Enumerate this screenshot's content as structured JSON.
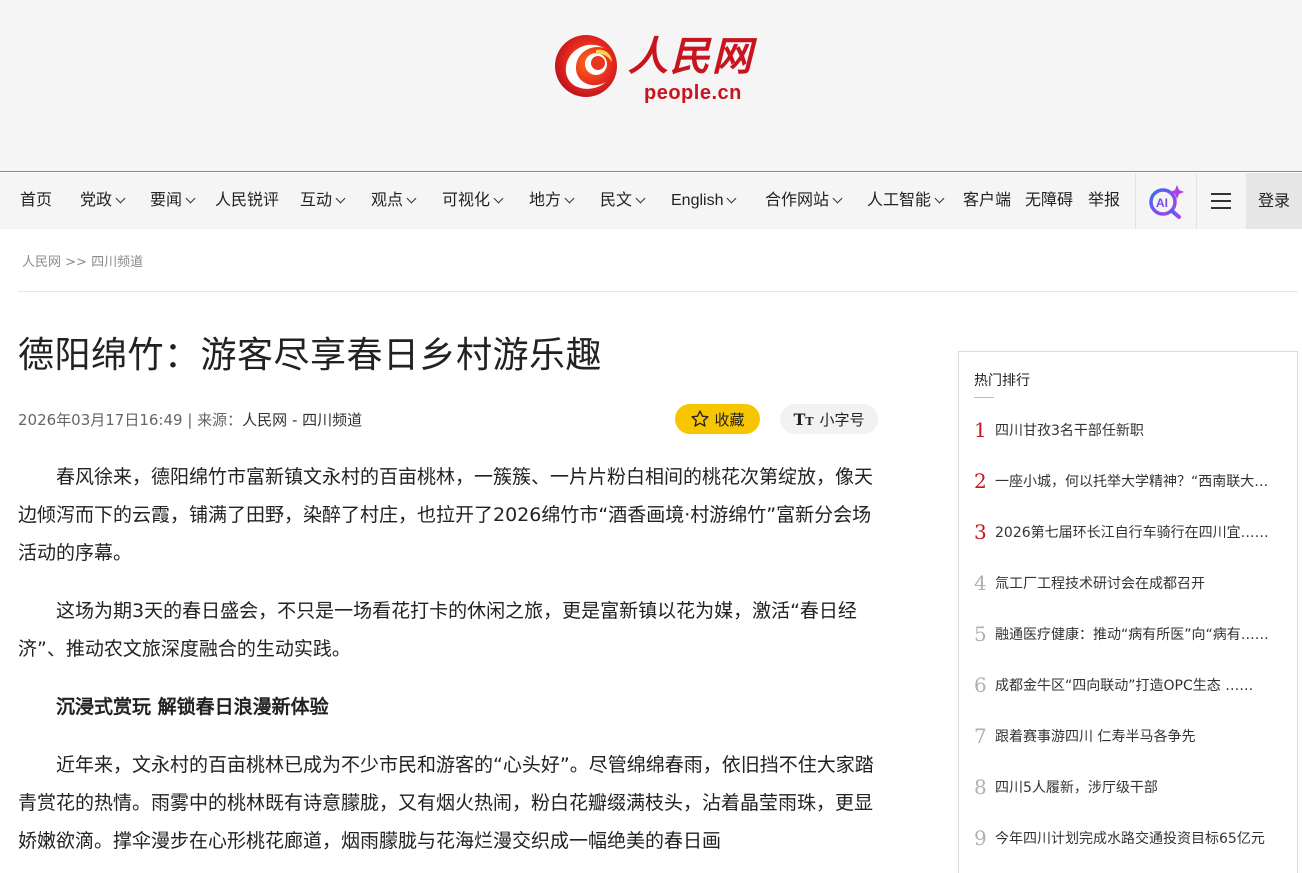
{
  "logo": {
    "cn": "人民网",
    "en": "people.cn",
    "brand_color": "#c8141e"
  },
  "nav": {
    "items": [
      {
        "label": "首页",
        "dropdown": false
      },
      {
        "label": "党政",
        "dropdown": true
      },
      {
        "label": "要闻",
        "dropdown": true
      },
      {
        "label": "人民锐评",
        "dropdown": false
      },
      {
        "label": "互动",
        "dropdown": true
      },
      {
        "label": "观点",
        "dropdown": true
      },
      {
        "label": "可视化",
        "dropdown": true
      },
      {
        "label": "地方",
        "dropdown": true
      },
      {
        "label": "民文",
        "dropdown": true
      },
      {
        "label": "English",
        "dropdown": true
      },
      {
        "label": "合作网站",
        "dropdown": true
      },
      {
        "label": "人工智能",
        "dropdown": true
      },
      {
        "label": "客户端",
        "dropdown": false
      },
      {
        "label": "无障碍",
        "dropdown": false
      },
      {
        "label": "举报",
        "dropdown": false
      }
    ],
    "ai_icon": "ai-search-icon",
    "menu_icon": "hamburger-menu-icon",
    "login": "登录"
  },
  "breadcrumb": {
    "home": "人民网",
    "sep": ">>",
    "channel": "四川频道"
  },
  "article": {
    "title": "德阳绵竹：游客尽享春日乡村游乐趣",
    "datetime": "2026年03月17日16:49",
    "source_prefix": " | 来源：",
    "source": "人民网 - 四川频道",
    "favorite_label": "收藏",
    "favorite_color": "#f7c600",
    "font_label": "小字号",
    "paragraphs": [
      "春风徐来，德阳绵竹市富新镇文永村的百亩桃林，一簇簇、一片片粉白相间的桃花次第绽放，像天边倾泻而下的云霞，铺满了田野，染醉了村庄，也拉开了2026绵竹市“酒香画境·村游绵竹”富新分会场活动的序幕。",
      "这场为期3天的春日盛会，不只是一场看花打卡的休闲之旅，更是富新镇以花为媒，激活“春日经济”、推动农文旅深度融合的生动实践。",
      "沉浸式赏玩 解锁春日浪漫新体验",
      "近年来，文永村的百亩桃林已成为不少市民和游客的“心头好”。尽管绵绵春雨，依旧挡不住大家踏青赏花的热情。雨雾中的桃林既有诗意朦胧，又有烟火热闹，粉白花瓣缀满枝头，沾着晶莹雨珠，更显娇嫩欲滴。撑伞漫步在心形桃花廊道，烟雨朦胧与花海烂漫交织成一幅绝美的春日画"
    ]
  },
  "sidebar": {
    "title": "热门排行",
    "hot_color": "#c8141e",
    "items": [
      {
        "rank": "1",
        "text": "四川甘孜3名干部任新职"
      },
      {
        "rank": "2",
        "text": "一座小城，何以托举大学精神？“西南联大……"
      },
      {
        "rank": "3",
        "text": "2026第七届环长江自行车骑行在四川宜……"
      },
      {
        "rank": "4",
        "text": "氚工厂工程技术研讨会在成都召开"
      },
      {
        "rank": "5",
        "text": "融通医疗健康：推动“病有所医”向“病有……"
      },
      {
        "rank": "6",
        "text": "成都金牛区“四向联动”打造OPC生态 ……"
      },
      {
        "rank": "7",
        "text": "跟着赛事游四川 仁寿半马各争先"
      },
      {
        "rank": "8",
        "text": "四川5人履新，涉厅级干部"
      },
      {
        "rank": "9",
        "text": "今年四川计划完成水路交通投资目标65亿元"
      }
    ]
  }
}
